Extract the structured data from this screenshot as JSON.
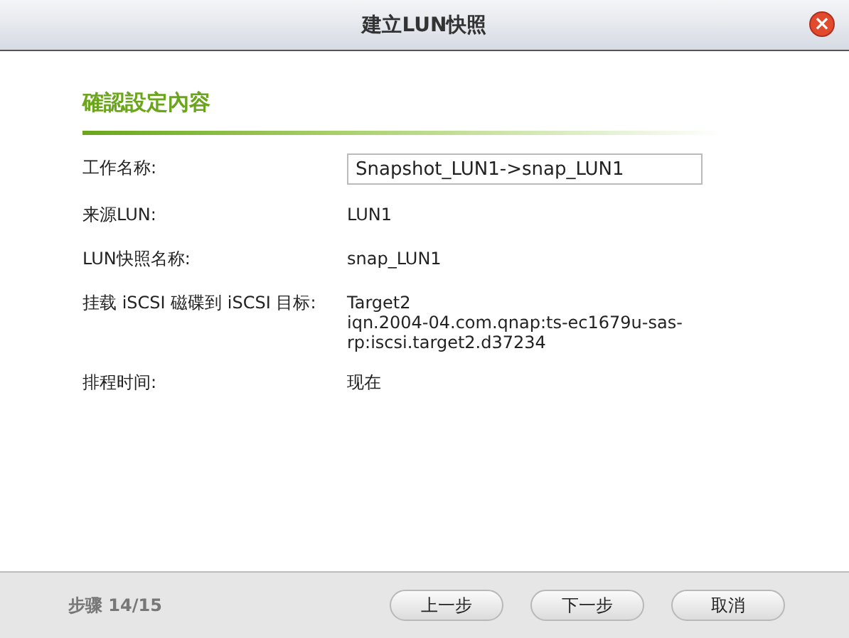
{
  "window": {
    "title": "建立LUN快照",
    "close": "×"
  },
  "section": {
    "title": "確認設定內容"
  },
  "rows": [
    {
      "label": "工作名称:",
      "kind": "field",
      "value": "Snapshot_LUN1->snap_LUN1"
    },
    {
      "label": "来源LUN:",
      "kind": "text",
      "lines": [
        "LUN1"
      ]
    },
    {
      "label": "LUN快照名称:",
      "kind": "text",
      "lines": [
        "snap_LUN1"
      ]
    },
    {
      "label": "挂载 iSCSI 磁碟到 iSCSI 目标:",
      "kind": "text",
      "lines": [
        "Target2",
        "iqn.2004-04.com.qnap:ts-ec1679u-sas-",
        "rp:iscsi.target2.d37234"
      ]
    },
    {
      "label": "排程时间:",
      "kind": "text",
      "lines": [
        "现在"
      ]
    }
  ],
  "footer": {
    "step": "步骤 14/15",
    "buttons": [
      "上一步",
      "下一步",
      "取消"
    ]
  }
}
